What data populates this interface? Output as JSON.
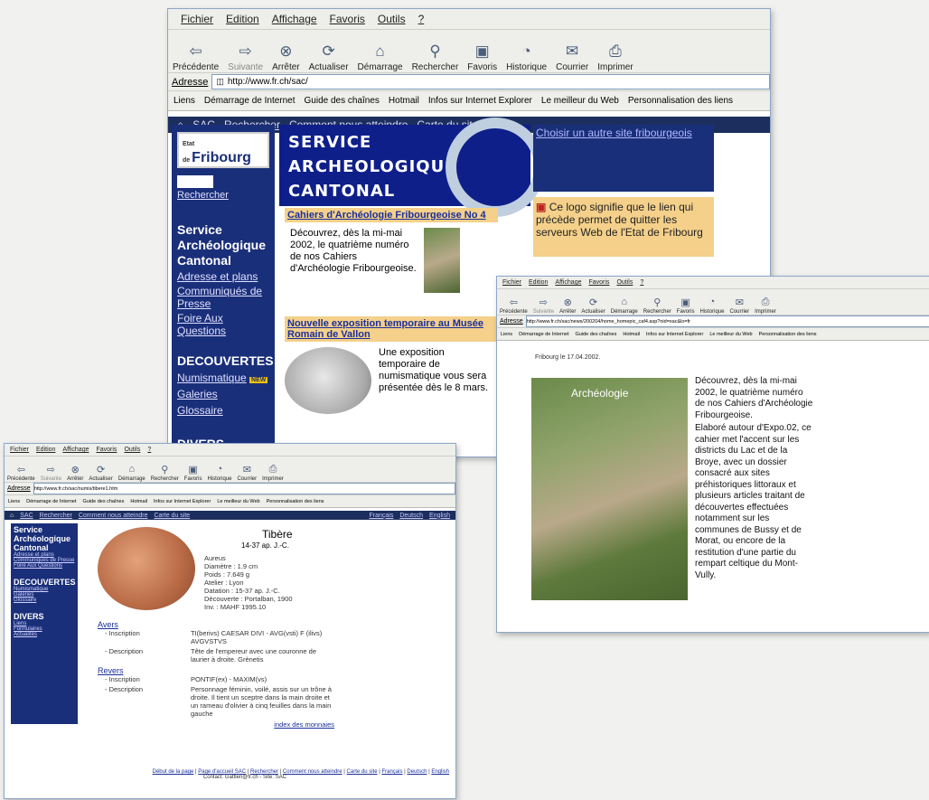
{
  "menu": [
    "Fichier",
    "Edition",
    "Affichage",
    "Favoris",
    "Outils",
    "?"
  ],
  "toolbar": [
    {
      "label": "Précédente",
      "icon": "back-arrow-icon",
      "glyph": "⇦"
    },
    {
      "label": "Suivante",
      "icon": "forward-arrow-icon",
      "glyph": "⇨"
    },
    {
      "label": "Arrêter",
      "icon": "stop-icon",
      "glyph": "⊗"
    },
    {
      "label": "Actualiser",
      "icon": "refresh-icon",
      "glyph": "⟳"
    },
    {
      "label": "Démarrage",
      "icon": "home-icon",
      "glyph": "⌂"
    },
    {
      "label": "Rechercher",
      "icon": "search-icon",
      "glyph": "⚲"
    },
    {
      "label": "Favoris",
      "icon": "favorites-icon",
      "glyph": "▣"
    },
    {
      "label": "Historique",
      "icon": "history-icon",
      "glyph": "◔"
    },
    {
      "label": "Courrier",
      "icon": "mail-icon",
      "glyph": "✉"
    },
    {
      "label": "Imprimer",
      "icon": "print-icon",
      "glyph": "⎙"
    }
  ],
  "address_label": "Adresse",
  "links_label": "Liens",
  "links": [
    "Démarrage de Internet",
    "Guide des chaînes",
    "Hotmail",
    "Infos sur Internet Explorer",
    "Le meilleur du Web",
    "Personnalisation des liens"
  ],
  "main": {
    "url": "http://www.fr.ch/sac/",
    "nav": [
      "SAC",
      "Rechercher",
      "Comment nous atteindre",
      "Carte du site"
    ],
    "logo_small": "Etat de",
    "logo": "Fribourg",
    "search_link": "Rechercher",
    "side_title": "Service Archéologique Cantonal",
    "side_links": [
      "Adresse et plans",
      "Communiqués de Presse",
      "Foire Aux Questions"
    ],
    "decouvertes": "DECOUVERTES",
    "decouvertes_links": [
      "Numismatique",
      "Galeries",
      "Glossaire"
    ],
    "new_badge": "NEW",
    "divers": "DIVERS",
    "banner": [
      "SERVICE",
      "ARCHEOLOGIQUE",
      "CANTONAL"
    ],
    "choose_site": "Choisir un autre site fribourgeois",
    "logo_note": "Ce logo signifie que le lien qui précède permet de quitter les serveurs Web de l'Etat de Fribourg",
    "news1_title": "Cahiers d'Archéologie Fribourgeoise No 4",
    "news1_text": "Découvrez, dès la mi-mai 2002, le quatrième numéro de nos Cahiers d'Archéologie Fribourgeoise.",
    "news2_title": "Nouvelle exposition temporaire au Musée Romain de Vallon",
    "news2_text": "Une exposition temporaire de numismatique vous sera présentée dès le 8 mars."
  },
  "cahier": {
    "url": "http://www.fr.ch/sac/news/200204/home_homepic_caf4.asp?nid=xac&lo=fr",
    "date": "Fribourg le 17.04.2002.",
    "cover_title": "Archéologie",
    "p1": "Découvrez, dès la mi-mai 2002, le quatrième numéro de nos Cahiers d'Archéologie Fribourgeoise.",
    "p2": "Elaboré autour d'Expo.02, ce cahier met l'accent sur les districts du Lac et de la Broye, avec un dossier consacré aux sites préhistoriques littoraux et plusieurs articles traitant de découvertes effectuées notamment sur les communes de Bussy et de Morat, ou encore de la restitution d'une partie du rempart celtique du Mont-Vully."
  },
  "tibere": {
    "url": "http://www.fr.ch/sac/numis/tibere1.htm",
    "nav": [
      "SAC",
      "Rechercher",
      "Comment nous atteindre",
      "Carte du site"
    ],
    "lang": [
      "Français",
      "Deutsch",
      "English"
    ],
    "side_title": "Service Archéologique Cantonal",
    "side_links": [
      "Adresse et plans",
      "Communiqués de Presse",
      "Foire Aux Questions"
    ],
    "decouvertes": "DECOUVERTES",
    "decouvertes_links": [
      "Numismatique",
      "Galeries",
      "Glossaire"
    ],
    "divers": "DIVERS",
    "divers_links": [
      "Liens",
      "Formulaires",
      "Actualités"
    ],
    "title": "Tibère",
    "dates": "14-37 ap. J.-C.",
    "specs": [
      "Aureus",
      "Diamètre : 1.9 cm",
      "Poids : 7.649 g",
      "Atelier : Lyon",
      "Datation : 15-37 ap. J.-C.",
      "Découverte : Portalban, 1900",
      "Inv. : MAHF 1995.10"
    ],
    "avers": "Avers",
    "revers": "Revers",
    "inscription_label": "- Inscription",
    "description_label": "- Description",
    "avers_inscription": "TI(berivs) CAESAR DIVI - AVG(vsti) F (ilivs) AVGVSTVS",
    "avers_description": "Tête de l'empereur avec une couronne de laurier à droite. Grènetis",
    "revers_inscription": "PONTIF(ex) - MAXIM(vs)",
    "revers_description": "Personnage féminin, voilé, assis sur un trône à droite. Il tient un sceptre dans la main droite et un rameau d'olivier à cinq feuilles dans la main gauche",
    "index_link": "index des monnaies",
    "footer_links": [
      "Début de la page",
      "Page d'accueil SAC",
      "Rechercher",
      "Comment nous atteindre",
      "Carte du site",
      "Français",
      "Deutsch",
      "English"
    ],
    "contact": "Contact: Gattlen@fr.ch - Site: SAC"
  }
}
